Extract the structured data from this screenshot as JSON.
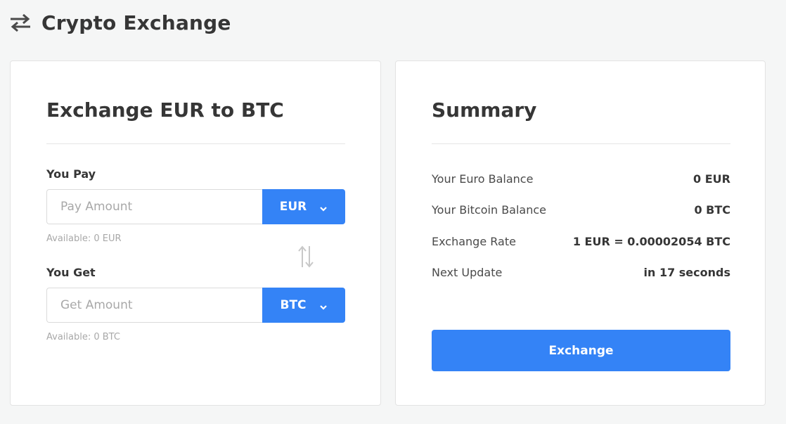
{
  "header": {
    "title": "Crypto Exchange",
    "icon": "swap-arrows-icon"
  },
  "exchange_card": {
    "title": "Exchange EUR to BTC",
    "pay": {
      "label": "You Pay",
      "placeholder": "Pay Amount",
      "value": "",
      "currency": "EUR",
      "available": "Available: 0 EUR"
    },
    "get": {
      "label": "You Get",
      "placeholder": "Get Amount",
      "value": "",
      "currency": "BTC",
      "available": "Available: 0 BTC"
    },
    "swap_icon": "swap-vertical-icon"
  },
  "summary_card": {
    "title": "Summary",
    "rows": [
      {
        "label": "Your Euro Balance",
        "value": "0 EUR"
      },
      {
        "label": "Your Bitcoin Balance",
        "value": "0 BTC"
      },
      {
        "label": "Exchange Rate",
        "value": "1 EUR = 0.00002054 BTC"
      },
      {
        "label": "Next Update",
        "value": "in 17 seconds"
      }
    ],
    "button_label": "Exchange"
  },
  "colors": {
    "accent": "#3483f6",
    "background": "#f5f6f6",
    "text": "#363636",
    "muted": "#a8a8a8"
  }
}
